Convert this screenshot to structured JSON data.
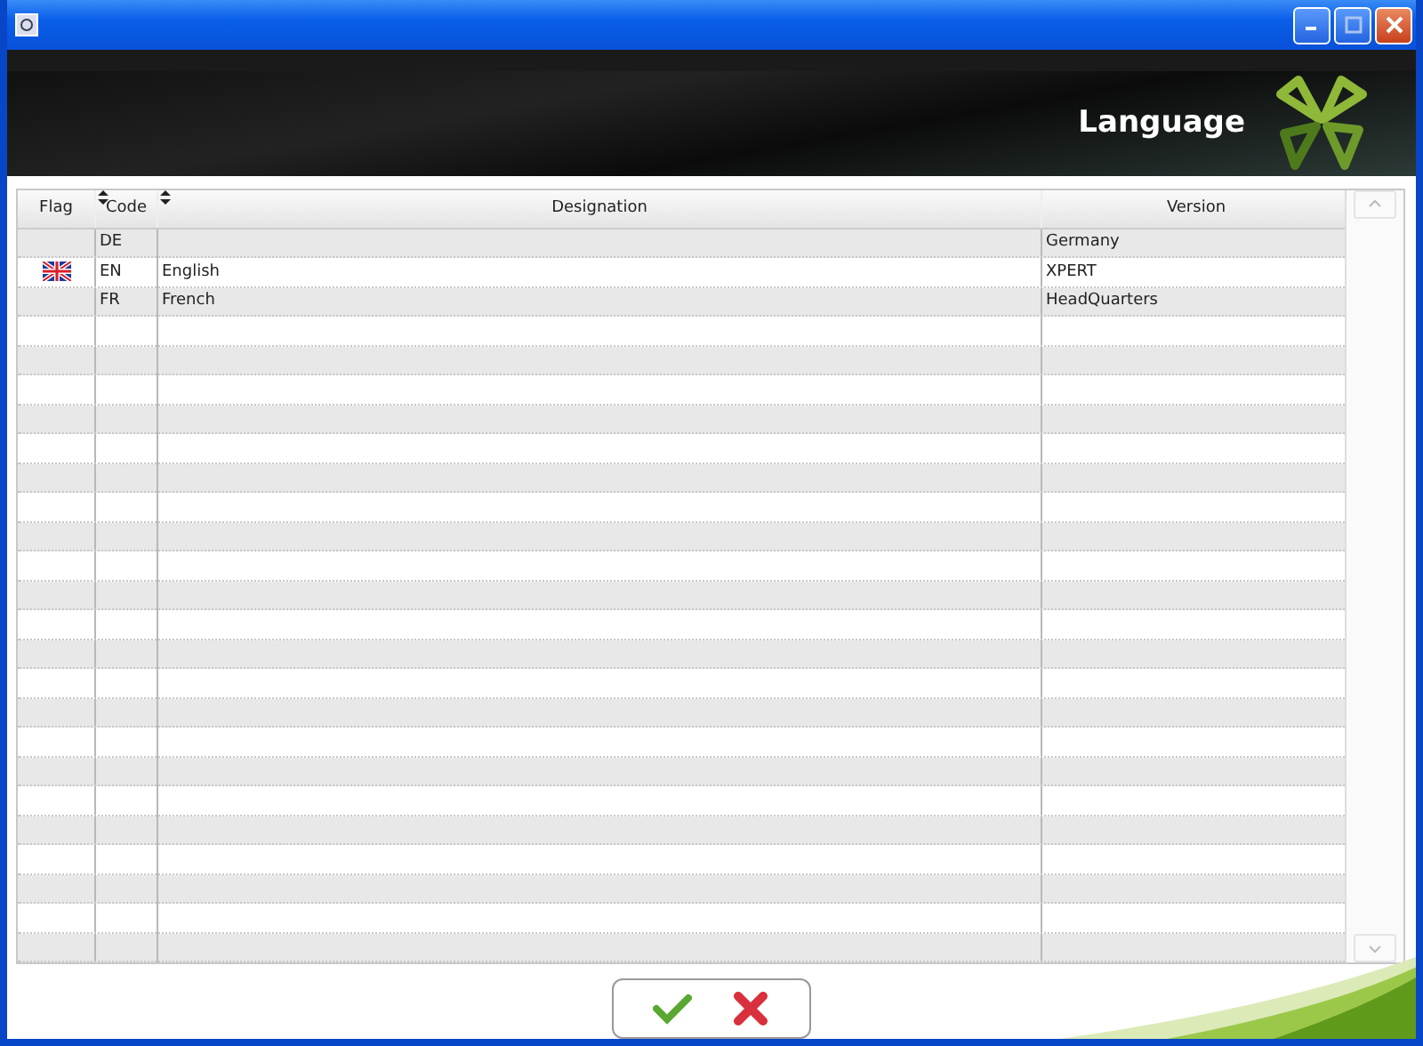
{
  "header": {
    "title": "Language"
  },
  "table": {
    "columns": [
      {
        "label": "Flag",
        "sortable": false
      },
      {
        "label": "Code",
        "sortable": true
      },
      {
        "label": "Designation",
        "sortable": true
      },
      {
        "label": "Version",
        "sortable": false
      }
    ],
    "rows": [
      {
        "flag_icon": false,
        "code": "DE",
        "designation": "",
        "version": "Germany"
      },
      {
        "flag_icon": true,
        "code": "EN",
        "designation": "English",
        "version": "XPERT"
      },
      {
        "flag_icon": false,
        "code": "FR",
        "designation": "French",
        "version": "HeadQuarters"
      }
    ]
  },
  "buttons": [
    {
      "kind": "confirm"
    },
    {
      "kind": "cancel"
    }
  ]
}
